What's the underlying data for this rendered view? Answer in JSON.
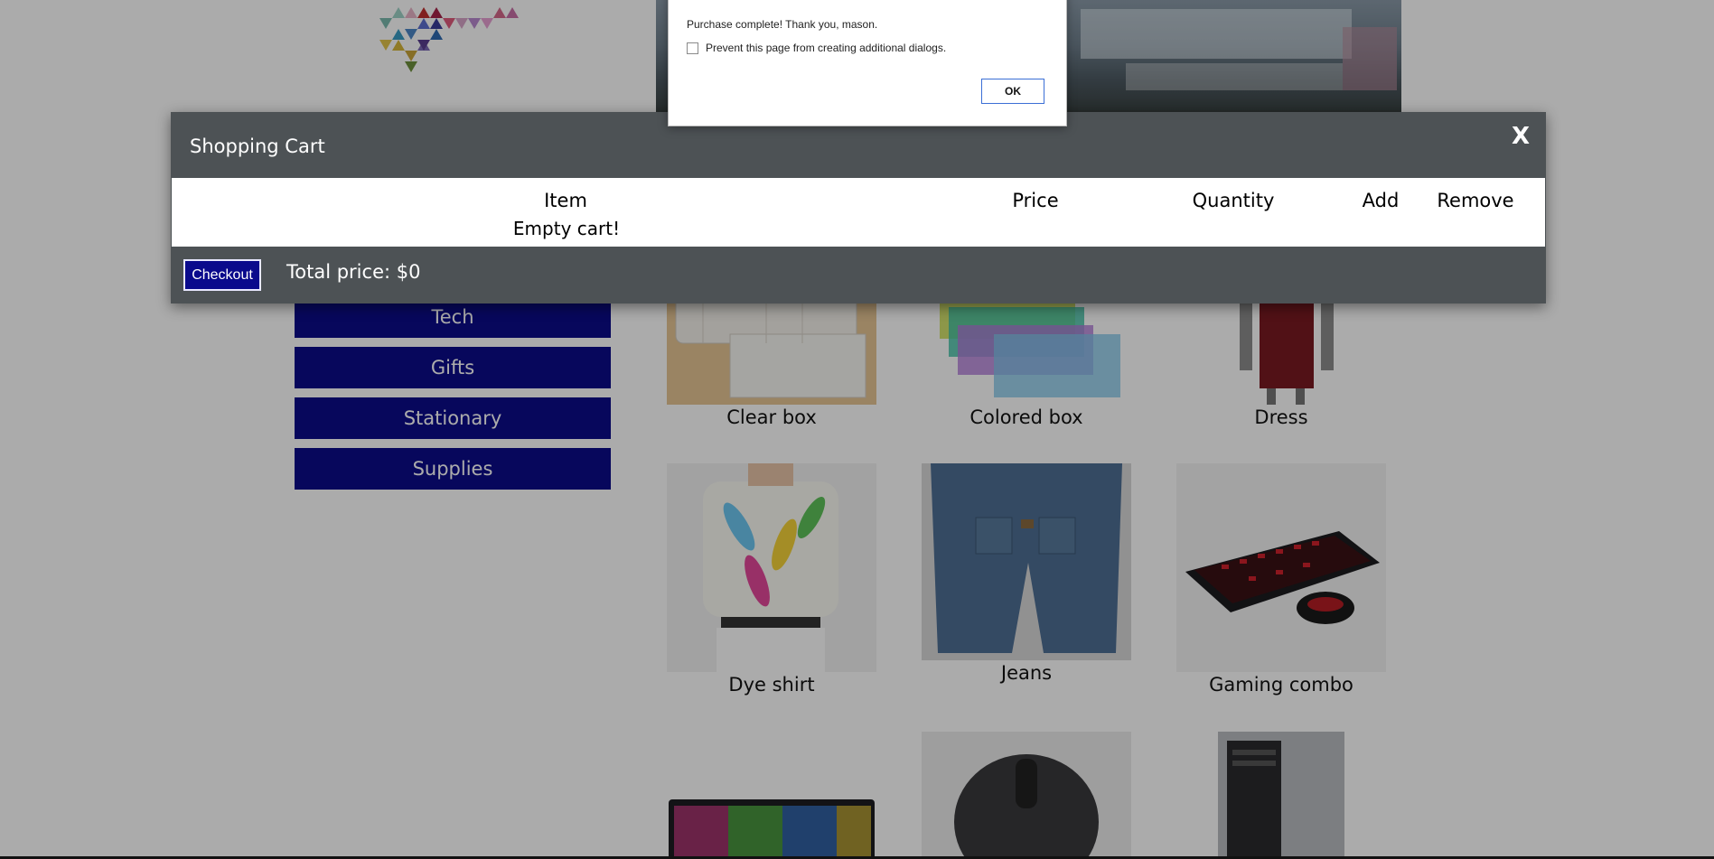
{
  "sidebar": {
    "items": [
      {
        "label": "Tech"
      },
      {
        "label": "Gifts"
      },
      {
        "label": "Stationary"
      },
      {
        "label": "Supplies"
      }
    ]
  },
  "products": [
    {
      "name": "Clear box"
    },
    {
      "name": "Colored box"
    },
    {
      "name": "Dress"
    },
    {
      "name": "Dye shirt"
    },
    {
      "name": "Jeans"
    },
    {
      "name": "Gaming combo"
    }
  ],
  "cart": {
    "title": "Shopping Cart",
    "close_label": "X",
    "columns": {
      "item": "Item",
      "price": "Price",
      "quantity": "Quantity",
      "add": "Add",
      "remove": "Remove"
    },
    "empty_message": "Empty cart!",
    "checkout_label": "Checkout",
    "total_label": "Total price: $0"
  },
  "alert": {
    "message": "Purchase complete! Thank you, mason.",
    "checkbox_label": "Prevent this page from creating additional dialogs.",
    "ok_label": "OK"
  },
  "colors": {
    "accent": "#0b0b8a",
    "modal_bg": "#4d5255",
    "overlay": "rgba(0,0,0,0.33)"
  }
}
